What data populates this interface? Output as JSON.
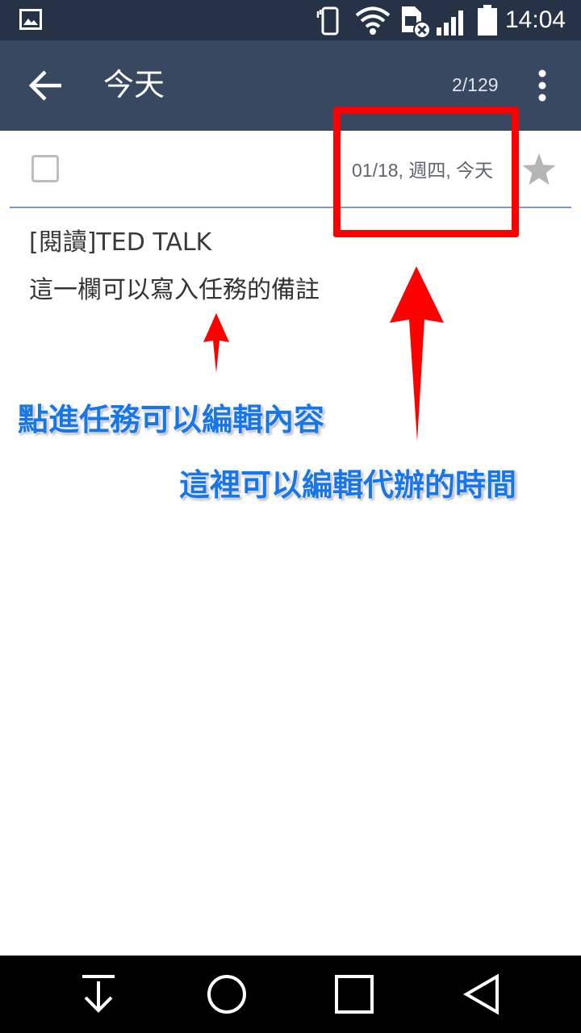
{
  "status_bar": {
    "time": "14:04",
    "icons": [
      "gallery-icon",
      "phone-vibrate-icon",
      "wifi-icon",
      "sim-off-icon",
      "signal-icon",
      "battery-icon"
    ]
  },
  "app_bar": {
    "back_icon": "arrow-back-icon",
    "title": "今天",
    "counter": "2/129",
    "more_icon": "more-vert-icon",
    "background": "#384861"
  },
  "task": {
    "checked": false,
    "date": "01/18, 週四, 今天",
    "starred": false,
    "title": "[閱讀]TED TALK",
    "note": "這一欄可以寫入任務的備註"
  },
  "annotations": {
    "color": "#ff0000",
    "text_color": "#1976e8",
    "edit_content": "點進任務可以編輯內容",
    "edit_time": "這裡可以編輯代辦的時間"
  },
  "nav_bar": {
    "buttons": [
      "download-icon",
      "home-icon",
      "recents-icon",
      "back-triangle-icon"
    ]
  }
}
